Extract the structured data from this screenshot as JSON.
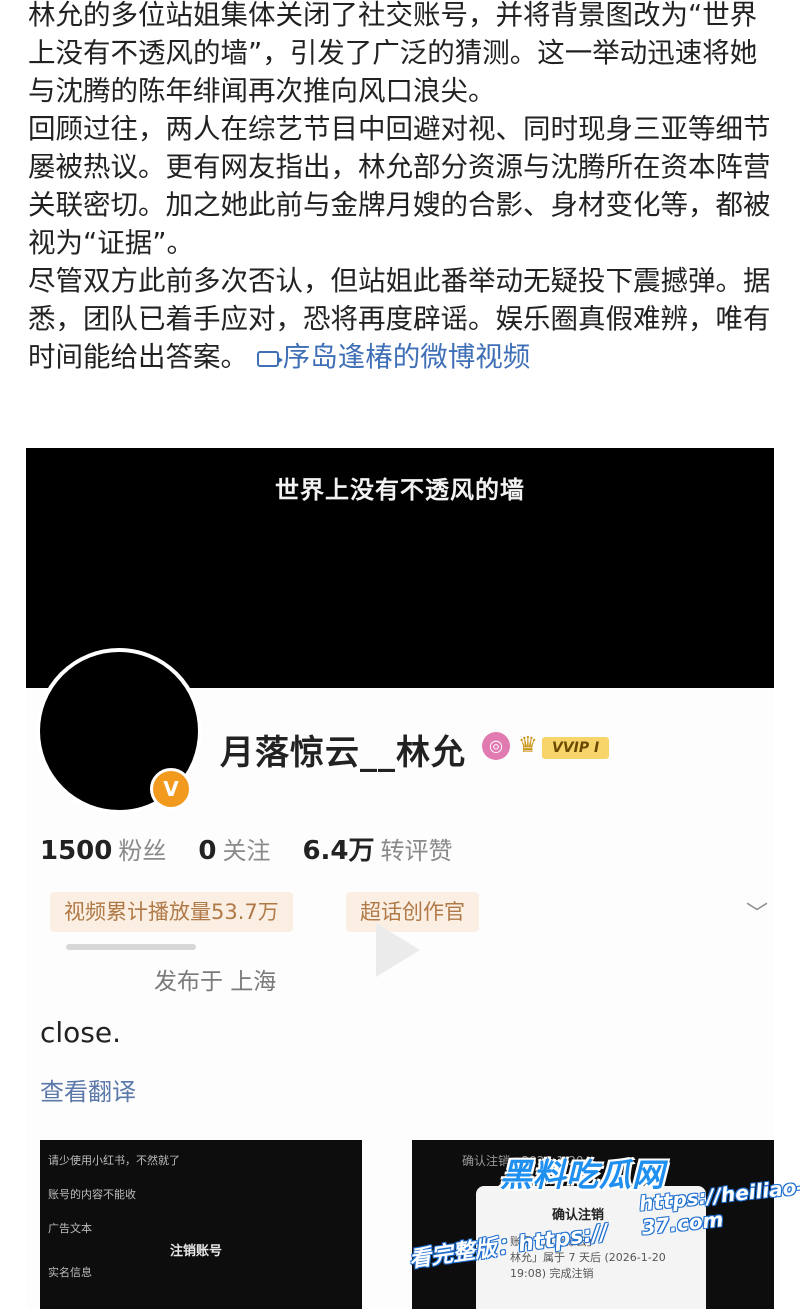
{
  "article": {
    "paragraph1": "林允的多位站姐集体关闭了社交账号，并将背景图改为“世界上没有不透风的墙”，引发了广泛的猜测。这一举动迅速将她与沈腾的陈年绯闻再次推向风口浪尖。",
    "paragraph2": "回顾过往，两人在综艺节目中回避对视、同时现身三亚等细节屡被热议。更有网友指出，林允部分资源与沈腾所在资本阵营关联密切。加之她此前与金牌月嫂的合影、身材变化等，都被视为“证据”。",
    "paragraph3": "尽管双方此前多次否认，但站姐此番举动无疑投下震撼弹。据悉，团队已着手应对，恐将再度辟谣。娱乐圈真假难辨，唯有时间能给出答案。",
    "video_link": "序岛逢椿的微博视频"
  },
  "profile": {
    "cover_text": "世界上没有不透风的墙",
    "verify_badge": "V",
    "username": "月落惊云__林允",
    "vip_tag": "VVIP Ⅰ",
    "stats": [
      {
        "value": "1500",
        "label": "粉丝"
      },
      {
        "value": "0",
        "label": "关注"
      },
      {
        "value": "6.4万",
        "label": "转评赞"
      }
    ],
    "chips": [
      "视频累计播放量53.7万",
      "超话创作官"
    ],
    "location": "发布于 上海",
    "post_text": "close.",
    "translate": "查看翻译"
  },
  "thumb1": {
    "lines": [
      "请少使用小红书，不然就了",
      "账号的内容不能收",
      "广告文本",
      "实名信息"
    ],
    "dialog_title": "注销账号"
  },
  "thumb2": {
    "top_line": "确认注销 · 2026-1-20",
    "popup_title": "确认注销",
    "popup_body": "账号「月落惊云」\n林允」属于 7 天后 (2026-1-20\n19:08) 完成注销"
  },
  "watermark": {
    "brand": "黑料吃瓜网",
    "url": "https://heiliao-37.com",
    "prompt": "看完整版：https://"
  },
  "colors": {
    "link": "#3f6fb6",
    "verify": "#f29a1e",
    "chip_bg": "#fbeee2",
    "chip_text": "#b07a48",
    "watermark": "#1f8ff0"
  }
}
